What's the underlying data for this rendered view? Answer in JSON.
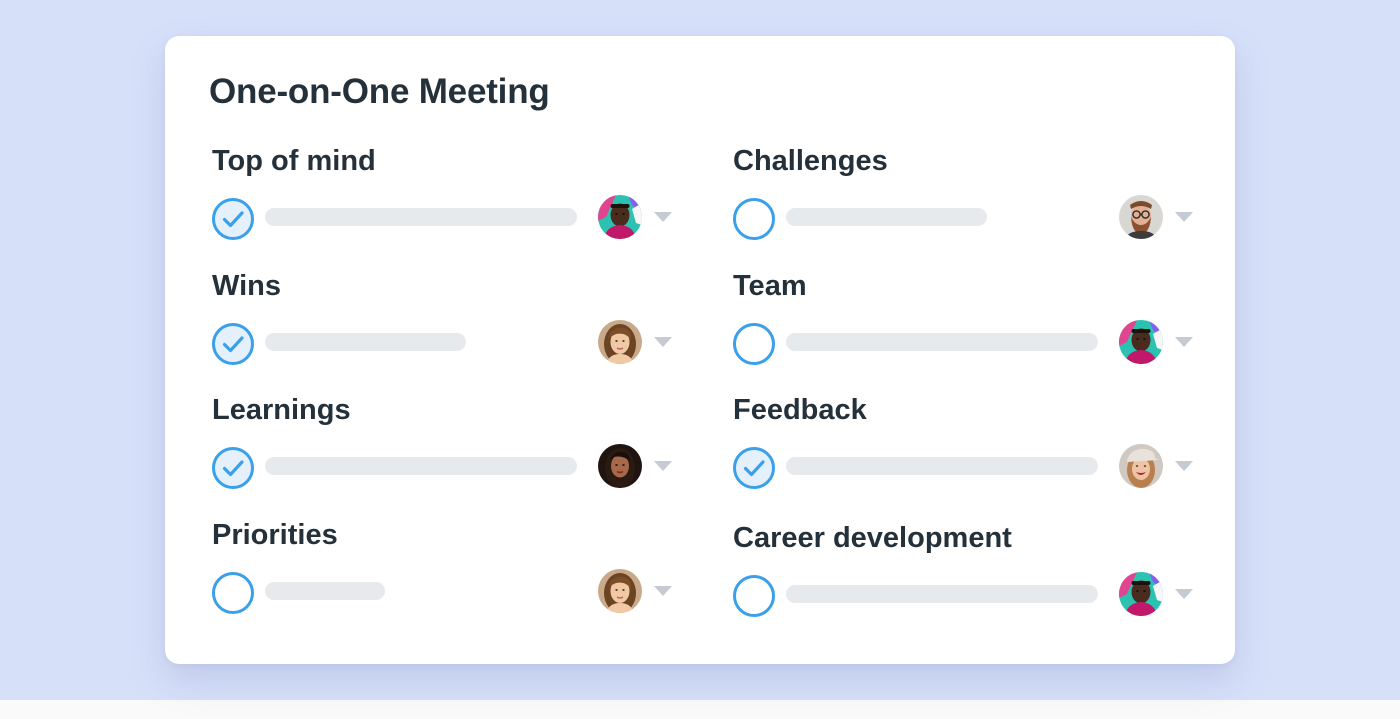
{
  "card": {
    "title": "One-on-One Meeting"
  },
  "sections": [
    {
      "label": "Top of mind",
      "checked": true,
      "bar_fill": 0.7,
      "avatar": "man-teal-bg"
    },
    {
      "label": "Wins",
      "checked": true,
      "bar_fill": 0.45,
      "avatar": "woman-light"
    },
    {
      "label": "Learnings",
      "checked": true,
      "bar_fill": 0.7,
      "avatar": "woman-dark"
    },
    {
      "label": "Priorities",
      "checked": false,
      "bar_fill": 0.27,
      "avatar": "woman-light"
    },
    {
      "label": "Challenges",
      "checked": false,
      "bar_fill": 0.45,
      "avatar": "man-beard-glasses"
    },
    {
      "label": "Team",
      "checked": false,
      "bar_fill": 0.7,
      "avatar": "man-teal-bg"
    },
    {
      "label": "Feedback",
      "checked": true,
      "bar_fill": 0.7,
      "avatar": "woman-cap"
    },
    {
      "label": "Career development",
      "checked": false,
      "bar_fill": 0.7,
      "avatar": "man-teal-bg"
    }
  ],
  "colors": {
    "background": "#d7e0f9",
    "accent": "#3ba0ea",
    "text": "#25313a",
    "bar": "#e7eaed",
    "caret": "#c5cbd2"
  },
  "icons": {
    "check": "check-circle-icon",
    "dropdown": "chevron-down-icon"
  }
}
